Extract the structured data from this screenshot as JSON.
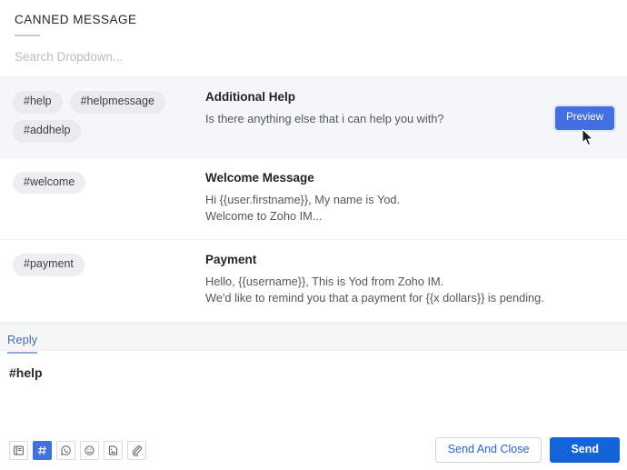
{
  "panel": {
    "title": "CANNED MESSAGE"
  },
  "search": {
    "placeholder": "Search Dropdown...",
    "value": ""
  },
  "messages": [
    {
      "tags": [
        "#help",
        "#helpmessage",
        "#addhelp"
      ],
      "title": "Additional Help",
      "lines": [
        "Is there anything else that i can help you with?"
      ],
      "action_label": "Preview",
      "highlighted": true
    },
    {
      "tags": [
        "#welcome"
      ],
      "title": "Welcome Message",
      "lines": [
        "Hi {{user.firstname}}, My name is Yod.",
        "Welcome to Zoho IM..."
      ],
      "action_label": "",
      "highlighted": false
    },
    {
      "tags": [
        "#payment"
      ],
      "title": "Payment",
      "lines": [
        "Hello, {{username}}, This is Yod from Zoho IM.",
        "We'd like to remind you that a payment for  {{x dollars}} is pending."
      ],
      "action_label": "",
      "highlighted": false
    }
  ],
  "reply": {
    "tab_label": "Reply",
    "composer_text": "#help"
  },
  "toolbar": {
    "icons": [
      {
        "name": "article-icon",
        "active": false
      },
      {
        "name": "hash-icon",
        "active": true
      },
      {
        "name": "whatsapp-icon",
        "active": false
      },
      {
        "name": "emoji-icon",
        "active": false
      },
      {
        "name": "image-icon",
        "active": false
      },
      {
        "name": "attachment-icon",
        "active": false
      }
    ],
    "send_and_close_label": "Send And Close",
    "send_label": "Send"
  },
  "colors": {
    "primary_blue": "#1463d9",
    "preview_blue": "#4270e0",
    "row_highlight": "#f5f6f9",
    "tag_bg": "#eceef1",
    "reply_bar_bg": "#f5f6f8"
  }
}
